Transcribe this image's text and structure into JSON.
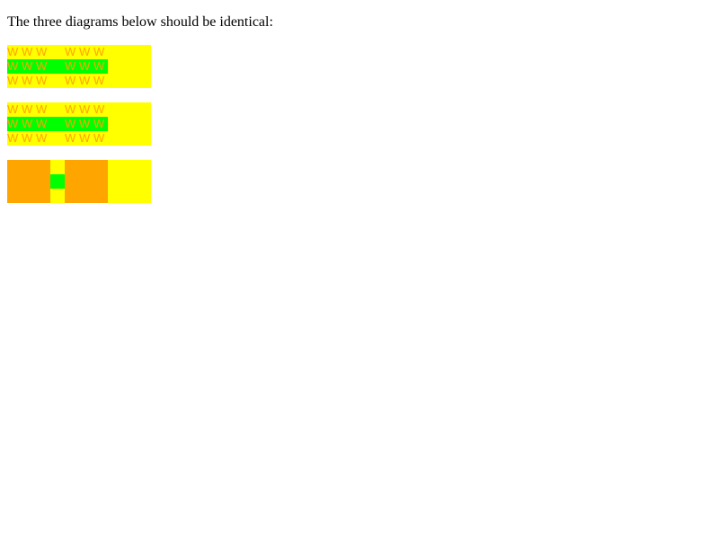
{
  "intro_text": "The three diagrams below should be identical:",
  "colors": {
    "yellow": "#ffff00",
    "green": "#00ff00",
    "orange": "#ffa500",
    "text": "#000000"
  },
  "diagram1": {
    "glyph": "W",
    "rows": [
      [
        "W",
        "W",
        "W",
        "W",
        "W",
        "W"
      ],
      [
        "W",
        "W",
        "W",
        "W",
        "W",
        "W"
      ],
      [
        "W",
        "W",
        "W",
        "W",
        "W",
        "W"
      ]
    ]
  },
  "diagram2": {
    "glyph": "W",
    "rows": [
      [
        "W",
        "W",
        "W",
        "W",
        "W",
        "W"
      ],
      [
        "W",
        "W",
        "W",
        "W",
        "W",
        "W"
      ],
      [
        "W",
        "W",
        "W",
        "W",
        "W",
        "W"
      ]
    ]
  }
}
